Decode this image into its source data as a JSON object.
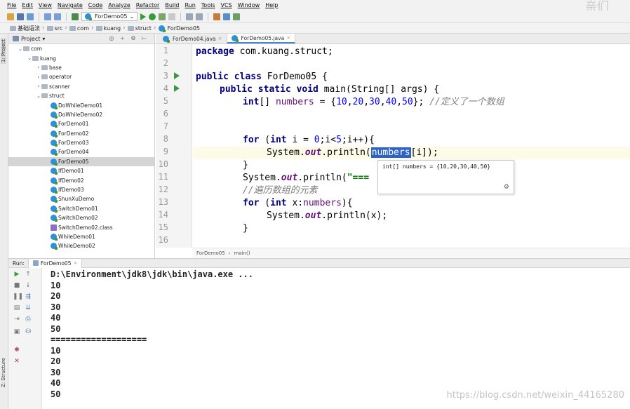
{
  "menu": [
    "File",
    "Edit",
    "View",
    "Navigate",
    "Code",
    "Analyze",
    "Refactor",
    "Build",
    "Run",
    "Tools",
    "VCS",
    "Window",
    "Help"
  ],
  "brand": "亲们",
  "toolbar": {
    "run_config": "ForDemo05"
  },
  "nav": {
    "items": [
      "基础语法",
      "src",
      "com",
      "kuang",
      "struct",
      "ForDemo05"
    ]
  },
  "left_strip": {
    "project_label": "1: Project"
  },
  "project_panel": {
    "title": "Project",
    "tree": [
      {
        "label": "com",
        "indent": 1,
        "arrow": "⌄",
        "icon": "folder"
      },
      {
        "label": "kuang",
        "indent": 2,
        "arrow": "⌄",
        "icon": "folder"
      },
      {
        "label": "base",
        "indent": 3,
        "arrow": "›",
        "icon": "folder"
      },
      {
        "label": "operator",
        "indent": 3,
        "arrow": "›",
        "icon": "folder"
      },
      {
        "label": "scanner",
        "indent": 3,
        "arrow": "›",
        "icon": "folder"
      },
      {
        "label": "struct",
        "indent": 3,
        "arrow": "⌄",
        "icon": "folder"
      },
      {
        "label": "DoWhileDemo01",
        "indent": 4,
        "icon": "class"
      },
      {
        "label": "DoWhileDemo02",
        "indent": 4,
        "icon": "class"
      },
      {
        "label": "ForDemo01",
        "indent": 4,
        "icon": "class"
      },
      {
        "label": "ForDemo02",
        "indent": 4,
        "icon": "class"
      },
      {
        "label": "ForDemo03",
        "indent": 4,
        "icon": "class"
      },
      {
        "label": "ForDemo04",
        "indent": 4,
        "icon": "class"
      },
      {
        "label": "ForDemo05",
        "indent": 4,
        "icon": "class",
        "selected": true
      },
      {
        "label": "IfDemo01",
        "indent": 4,
        "icon": "class"
      },
      {
        "label": "IfDemo02",
        "indent": 4,
        "icon": "class"
      },
      {
        "label": "IfDemo03",
        "indent": 4,
        "icon": "class"
      },
      {
        "label": "ShunXuDemo",
        "indent": 4,
        "icon": "class"
      },
      {
        "label": "SwitchDemo01",
        "indent": 4,
        "icon": "class"
      },
      {
        "label": "SwitchDemo02",
        "indent": 4,
        "icon": "class"
      },
      {
        "label": "SwitchDemo02.class",
        "indent": 4,
        "icon": "classfile"
      },
      {
        "label": "WhileDemo01",
        "indent": 4,
        "icon": "class"
      },
      {
        "label": "WhileDemo02",
        "indent": 4,
        "icon": "class"
      }
    ]
  },
  "editor": {
    "tabs": [
      {
        "label": "ForDemo04.java",
        "active": false
      },
      {
        "label": "ForDemo05.java",
        "active": true
      }
    ],
    "line_numbers": [
      "1",
      "2",
      "3",
      "4",
      "5",
      "6",
      "7",
      "8",
      "9",
      "10",
      "11",
      "12",
      "13",
      "14",
      "15",
      "16"
    ],
    "code": {
      "l1_kw": "package",
      "l1_rest": " com.kuang.struct;",
      "l3_kw": "public class",
      "l3_rest": " ForDemo05 {",
      "l4_kw": "public static void",
      "l4_rest": " main(String[] args) {",
      "l5_kw": "int",
      "l5_a": "[] ",
      "l5_var": "numbers",
      "l5_b": " = {",
      "l5_n1": "10",
      "l5_n2": "20",
      "l5_n3": "30",
      "l5_n4": "40",
      "l5_n5": "50",
      "l5_c": "}; ",
      "l5_comment": "//定义了一个数组",
      "l8_kw": "for",
      "l8_a": " (",
      "l8_kw2": "int",
      "l8_b": " i = ",
      "l8_n0": "0",
      "l8_c": ";i<",
      "l8_n5": "5",
      "l8_d": ";i++){",
      "l9_a": "System.",
      "l9_out": "out",
      "l9_b": ".println(",
      "l9_hl": "numbers",
      "l9_c": "[i]);",
      "l10": "}",
      "l11_a": "System.",
      "l11_out": "out",
      "l11_b": ".println(",
      "l11_str": "\"===",
      "l12_comment": "//遍历数组的元素",
      "l13_kw": "for",
      "l13_a": " (",
      "l13_kw2": "int",
      "l13_b": " x:",
      "l13_var": "numbers",
      "l13_c": "){",
      "l14_a": "System.",
      "l14_out": "out",
      "l14_b": ".println(x);",
      "l15": "}"
    },
    "tooltip": "int[] numbers = {10,20,30,40,50}",
    "breadcrumb": [
      "ForDemo05",
      "main()"
    ]
  },
  "run_panel": {
    "label": "Run:",
    "tab": "ForDemo05",
    "output": [
      "D:\\Environment\\jdk8\\jdk\\bin\\java.exe ...",
      "10",
      "20",
      "30",
      "40",
      "50",
      "===================",
      "10",
      "20",
      "30",
      "40",
      "50"
    ]
  },
  "structure_label": "Z: Structure",
  "watermark": "https://blog.csdn.net/weixin_44165280",
  "colors": {
    "keyword": "#000080",
    "number": "#0000ff",
    "field": "#660e7a",
    "comment": "#808080",
    "selection": "#2e63c5",
    "run_green": "#3a9a3a"
  }
}
